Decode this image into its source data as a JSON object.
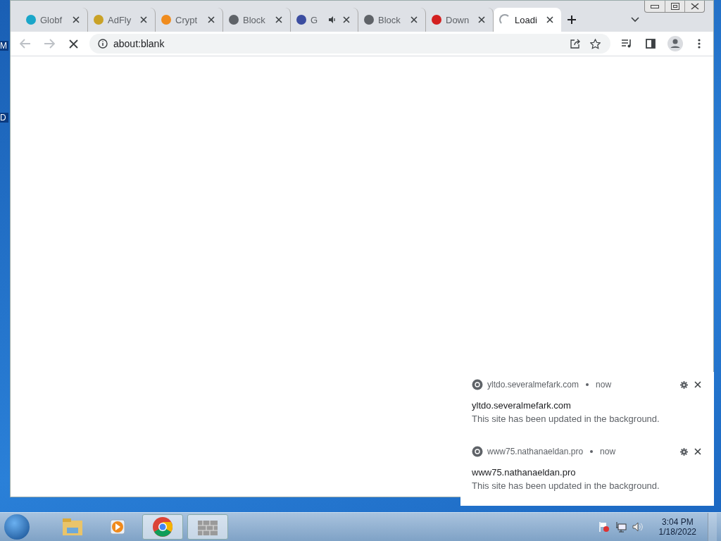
{
  "desktop": {
    "icon_labels": [
      "M",
      "D"
    ]
  },
  "browser": {
    "tabs": [
      {
        "title": "Globf",
        "selected": false,
        "audio": false,
        "loading": false,
        "color": "#1aa6c9"
      },
      {
        "title": "AdFly",
        "selected": false,
        "audio": false,
        "loading": false,
        "color": "#c9a227"
      },
      {
        "title": "Crypt",
        "selected": false,
        "audio": false,
        "loading": false,
        "color": "#f08c1e"
      },
      {
        "title": "Block",
        "selected": false,
        "audio": false,
        "loading": false,
        "color": "#5f6368"
      },
      {
        "title": "G",
        "selected": false,
        "audio": true,
        "loading": false,
        "color": "#3b4da0"
      },
      {
        "title": "Block",
        "selected": false,
        "audio": false,
        "loading": false,
        "color": "#5f6368"
      },
      {
        "title": "Down",
        "selected": false,
        "audio": false,
        "loading": false,
        "color": "#d32020"
      },
      {
        "title": "Loadi",
        "selected": true,
        "audio": false,
        "loading": true,
        "color": "#9aa0a6"
      }
    ],
    "address": "about:blank"
  },
  "notifications": [
    {
      "source": "yltdo.severalmefark.com",
      "time": "now",
      "title": "yltdo.severalmefark.com",
      "body": "This site has been updated in the background."
    },
    {
      "source": "www75.nathanaeldan.pro",
      "time": "now",
      "title": "www75.nathanaeldan.pro",
      "body": "This site has been updated in the background."
    }
  ],
  "taskbar": {
    "apps": [
      {
        "kind": "explorer",
        "selected": false
      },
      {
        "kind": "media",
        "selected": false
      },
      {
        "kind": "chrome",
        "selected": true
      },
      {
        "kind": "firewall",
        "selected": true
      }
    ],
    "time": "3:04 PM",
    "date": "1/18/2022"
  }
}
